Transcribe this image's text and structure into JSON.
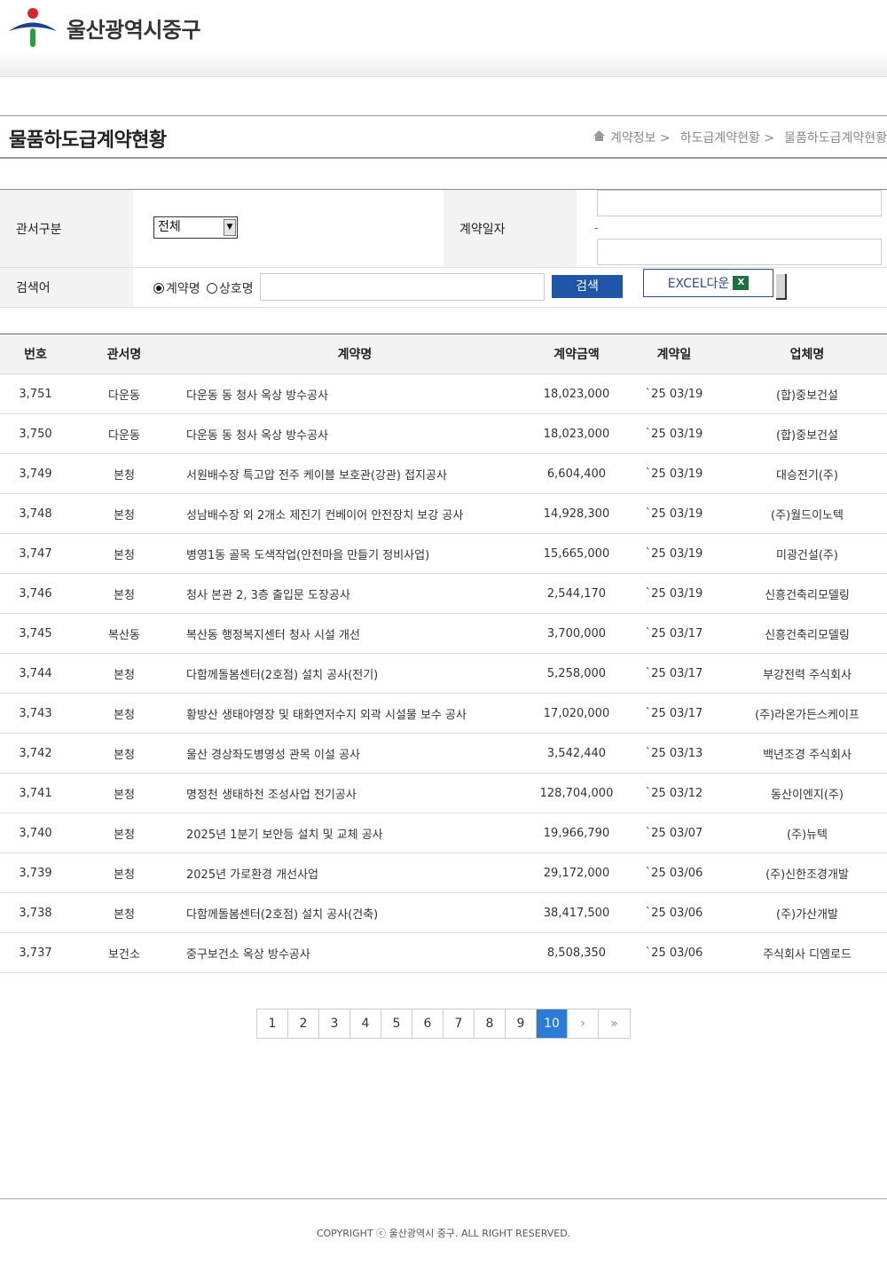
{
  "logo": {
    "text": "울산광역시중구"
  },
  "title_bar": {
    "title": "물품하도급계약현황",
    "breadcrumb": [
      "계약정보 >",
      "하도급계약현황 >",
      "물품하도급계약현황"
    ]
  },
  "search": {
    "office_label": "관서구분",
    "office_selected": "전체",
    "date_label": "계약일자",
    "date_separator": "-",
    "keyword_label": "검색어",
    "radio_contract": "계약명",
    "radio_company": "상호명",
    "search_button": "검색",
    "excel_button": "EXCEL다운",
    "excel_icon": "X"
  },
  "table": {
    "headers": [
      "번호",
      "관서명",
      "계약명",
      "계약금액",
      "계약일",
      "업체명"
    ],
    "rows": [
      [
        "3,751",
        "다운동",
        "다운동 동 청사 옥상 방수공사",
        "18,023,000",
        "`25 03/19",
        "(합)중보건설"
      ],
      [
        "3,750",
        "다운동",
        "다운동 동 청사 옥상 방수공사",
        "18,023,000",
        "`25 03/19",
        "(합)중보건설"
      ],
      [
        "3,749",
        "본청",
        "서원배수장 특고압 전주 케이블 보호관(강관) 접지공사",
        "6,604,400",
        "`25 03/19",
        "대승전기(주)"
      ],
      [
        "3,748",
        "본청",
        "성남배수장 외 2개소 제진기 컨베이어 안전장치 보강 공사",
        "14,928,300",
        "`25 03/19",
        "(주)월드이노텍"
      ],
      [
        "3,747",
        "본청",
        "병영1동 골목 도색작업(안전마을 만들기 정비사업)",
        "15,665,000",
        "`25 03/19",
        "미광건설(주)"
      ],
      [
        "3,746",
        "본청",
        "청사 본관 2, 3층 출입문 도장공사",
        "2,544,170",
        "`25 03/19",
        "신흥건축리모델링"
      ],
      [
        "3,745",
        "복산동",
        "복산동 행정복지센터 청사 시설 개선",
        "3,700,000",
        "`25 03/17",
        "신흥건축리모델링"
      ],
      [
        "3,744",
        "본청",
        "다함께돌봄센터(2호점) 설치 공사(전기)",
        "5,258,000",
        "`25 03/17",
        "부강전력 주식회사"
      ],
      [
        "3,743",
        "본청",
        "황방산 생태야영장 및 태화연저수지 외곽 시설물 보수 공사",
        "17,020,000",
        "`25 03/17",
        "(주)라온가든스케이프"
      ],
      [
        "3,742",
        "본청",
        "울산 경상좌도병영성 관목 이설 공사",
        "3,542,440",
        "`25 03/13",
        "백년조경 주식회사"
      ],
      [
        "3,741",
        "본청",
        "명정천 생태하천 조성사업 전기공사",
        "128,704,000",
        "`25 03/12",
        "동산이엔지(주)"
      ],
      [
        "3,740",
        "본청",
        "2025년 1분기 보안등 설치 및 교체 공사",
        "19,966,790",
        "`25 03/07",
        "(주)뉴텍"
      ],
      [
        "3,739",
        "본청",
        "2025년 가로환경 개선사업",
        "29,172,000",
        "`25 03/06",
        "(주)신한조경개발"
      ],
      [
        "3,738",
        "본청",
        "다함께돌봄센터(2호점) 설치 공사(건축)",
        "38,417,500",
        "`25 03/06",
        "(주)가산개발"
      ],
      [
        "3,737",
        "보건소",
        "중구보건소 옥상 방수공사",
        "8,508,350",
        "`25 03/06",
        "주식회사 디엠로드"
      ]
    ]
  },
  "pagination": {
    "pages": [
      "1",
      "2",
      "3",
      "4",
      "5",
      "6",
      "7",
      "8",
      "9",
      "10"
    ],
    "current": "10",
    "next": "›",
    "last": "»"
  },
  "footer": {
    "copyright": "COPYRIGHT ⓒ 울산광역시 중구. ALL RIGHT RESERVED."
  },
  "colors": {
    "search_button": "#1f56a8",
    "active_page": "#2d7bd8",
    "excel_icon": "#1e7145"
  }
}
